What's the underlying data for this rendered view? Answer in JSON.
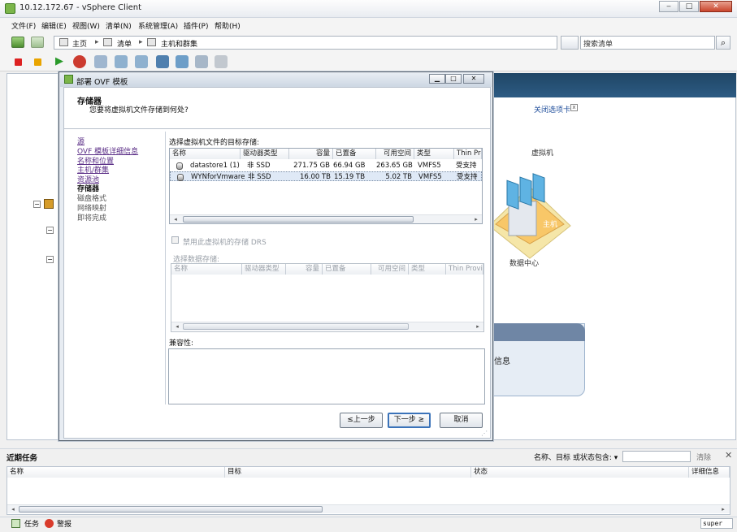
{
  "window": {
    "title": "10.12.172.67 - vSphere Client"
  },
  "menu": [
    "文件(F)",
    "编辑(E)",
    "视图(W)",
    "清单(N)",
    "系统管理(A)",
    "插件(P)",
    "帮助(H)"
  ],
  "breadcrumb": {
    "home": "主页",
    "inventory": "清单",
    "hosts": "主机和群集"
  },
  "search": {
    "placeholder": "搜索清单"
  },
  "main": {
    "close_tab": "关闭选项卡",
    "vm_label": "虚拟机",
    "host_label": "主机",
    "datacenter_label": "数据中心",
    "info_text": "信息"
  },
  "dialog": {
    "title": "部署 OVF 模板",
    "header_title": "存储器",
    "header_subtitle": "您要将虚拟机文件存储到何处?",
    "steps": [
      {
        "label": "源",
        "state": "link"
      },
      {
        "label": "OVF 模板详细信息",
        "state": "link"
      },
      {
        "label": "名称和位置",
        "state": "link"
      },
      {
        "label": "主机/群集",
        "state": "link"
      },
      {
        "label": "资源池",
        "state": "link"
      },
      {
        "label": "存储器",
        "state": "current"
      },
      {
        "label": "磁盘格式",
        "state": "pending"
      },
      {
        "label": "网络映射",
        "state": "pending"
      },
      {
        "label": "即将完成",
        "state": "pending"
      }
    ],
    "target_label": "选择虚拟机文件的目标存储:",
    "columns": [
      "名称",
      "驱动器类型",
      "容量",
      "已置备",
      "可用空间",
      "类型",
      "Thin Provi"
    ],
    "datastores": [
      {
        "name": "datastore1 (1)",
        "drive": "非 SSD",
        "capacity": "271.75 GB",
        "provisioned": "66.94 GB",
        "free": "263.65 GB",
        "type": "VMFS5",
        "thin": "受支持"
      },
      {
        "name": "WYNforVmware",
        "drive": "非 SSD",
        "capacity": "16.00 TB",
        "provisioned": "15.19 TB",
        "free": "5.02 TB",
        "type": "VMFS5",
        "thin": "受支持"
      }
    ],
    "drs_label": "禁用此虚拟机的存储 DRS",
    "datastore_select_label": "选择数据存储:",
    "compat_label": "兼容性:",
    "back_button": "≤上一步",
    "next_button": "下一步 ≥",
    "cancel_button": "取消"
  },
  "tasks": {
    "title": "近期任务",
    "filter_label": "名称、目标 或状态包含: ▾",
    "clear": "清除",
    "columns": [
      "名称",
      "目标",
      "状态",
      "详细信息"
    ]
  },
  "statusbar": {
    "tasks": "任务",
    "alarms": "警报",
    "user": "super"
  },
  "colors": {
    "header_blue": "#2d5b83",
    "link_purple": "#5a2d86",
    "selection": "#dfe9f6"
  }
}
